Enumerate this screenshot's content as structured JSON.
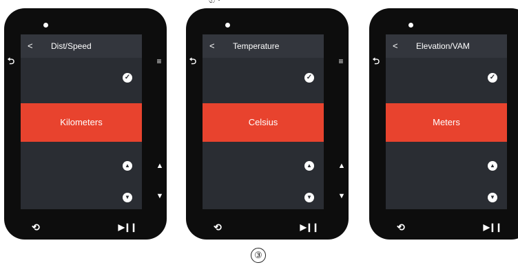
{
  "caption_fragment": "ග       ·",
  "step_label": "③",
  "accent_color": "#e8432e",
  "devices": [
    {
      "title": "Dist/Speed",
      "selected_option": "Kilometers",
      "back_chevron": "<",
      "check_icon": "✓",
      "up_icon": "▲",
      "down_icon": "▼",
      "side_back": "⮌",
      "side_enter": "≡",
      "side_up": "▲",
      "side_down": "▼",
      "bottom_left": "⟲",
      "bottom_right": "▶❙❙"
    },
    {
      "title": "Temperature",
      "selected_option": "Celsius",
      "back_chevron": "<",
      "check_icon": "✓",
      "up_icon": "▲",
      "down_icon": "▼",
      "side_back": "⮌",
      "side_enter": "≡",
      "side_up": "▲",
      "side_down": "▼",
      "bottom_left": "⟲",
      "bottom_right": "▶❙❙"
    },
    {
      "title": "Elevation/VAM",
      "selected_option": "Meters",
      "back_chevron": "<",
      "check_icon": "✓",
      "up_icon": "▲",
      "down_icon": "▼",
      "side_back": "⮌",
      "side_enter": "≡",
      "side_up": "▲",
      "side_down": "▼",
      "bottom_left": "⟲",
      "bottom_right": "▶❙❙"
    }
  ]
}
